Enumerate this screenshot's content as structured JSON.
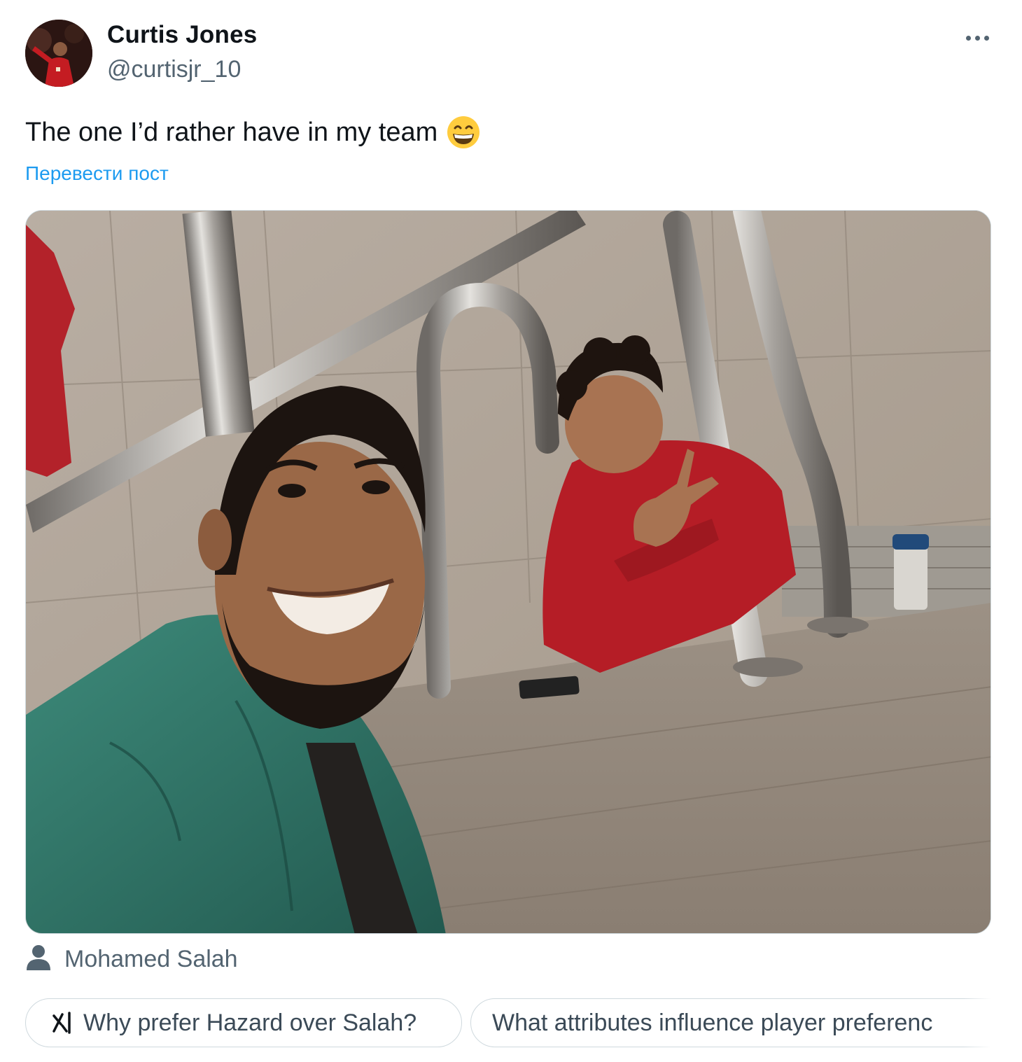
{
  "author": {
    "name": "Curtis Jones",
    "handle": "@curtisjr_10"
  },
  "post": {
    "text": "The one I’d rather have in my team",
    "emoji_icon": "grinning-face-emoji",
    "translate_label": "Перевести пост"
  },
  "media": {
    "tagged_user": "Mohamed Salah",
    "tag_icon": "person-icon"
  },
  "suggestions": [
    {
      "icon": "grok-icon",
      "label": "Why prefer Hazard over Salah?"
    },
    {
      "label": "What attributes influence player preferenc"
    }
  ],
  "colors": {
    "link": "#1d9bf0",
    "secondary_text": "#536471",
    "primary_text": "#0f1419",
    "border": "#cfd9de"
  }
}
